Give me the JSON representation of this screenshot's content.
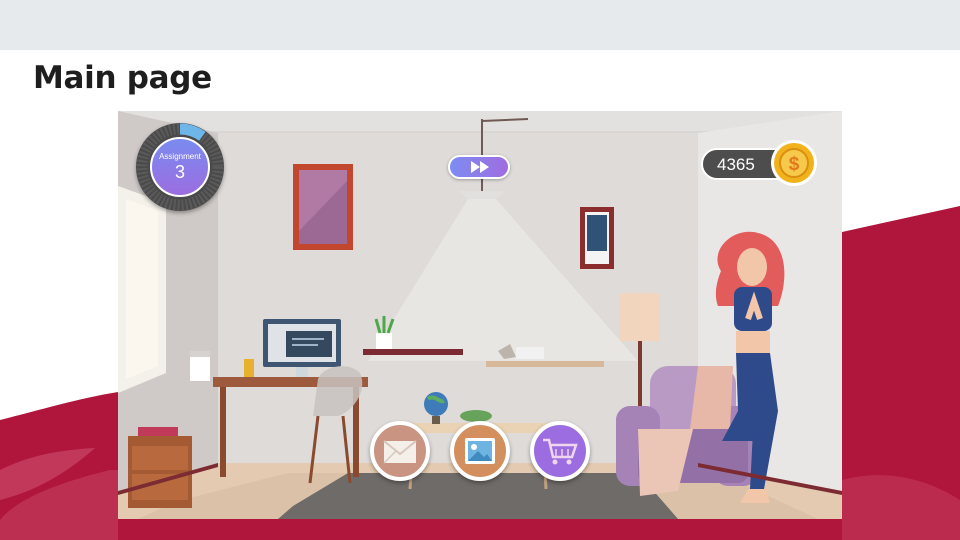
{
  "page": {
    "title": "Main page"
  },
  "hud": {
    "assignment": {
      "label": "Assignment",
      "count": "3",
      "progress": 0.1
    },
    "coins": {
      "value": "4365",
      "symbol": "$"
    },
    "speed_icon": "fast-forward-icon"
  },
  "actions": [
    {
      "name": "mail",
      "icon": "envelope-icon"
    },
    {
      "name": "gallery",
      "icon": "image-icon"
    },
    {
      "name": "shop",
      "icon": "shopping-cart-icon"
    }
  ],
  "colors": {
    "brand_crimson": "#b0163c",
    "hud_gradient_start": "#7a8bf0",
    "hud_gradient_end": "#9b6de0",
    "coin_gold": "#f2b21b",
    "hud_dark": "#4d4d4d"
  }
}
